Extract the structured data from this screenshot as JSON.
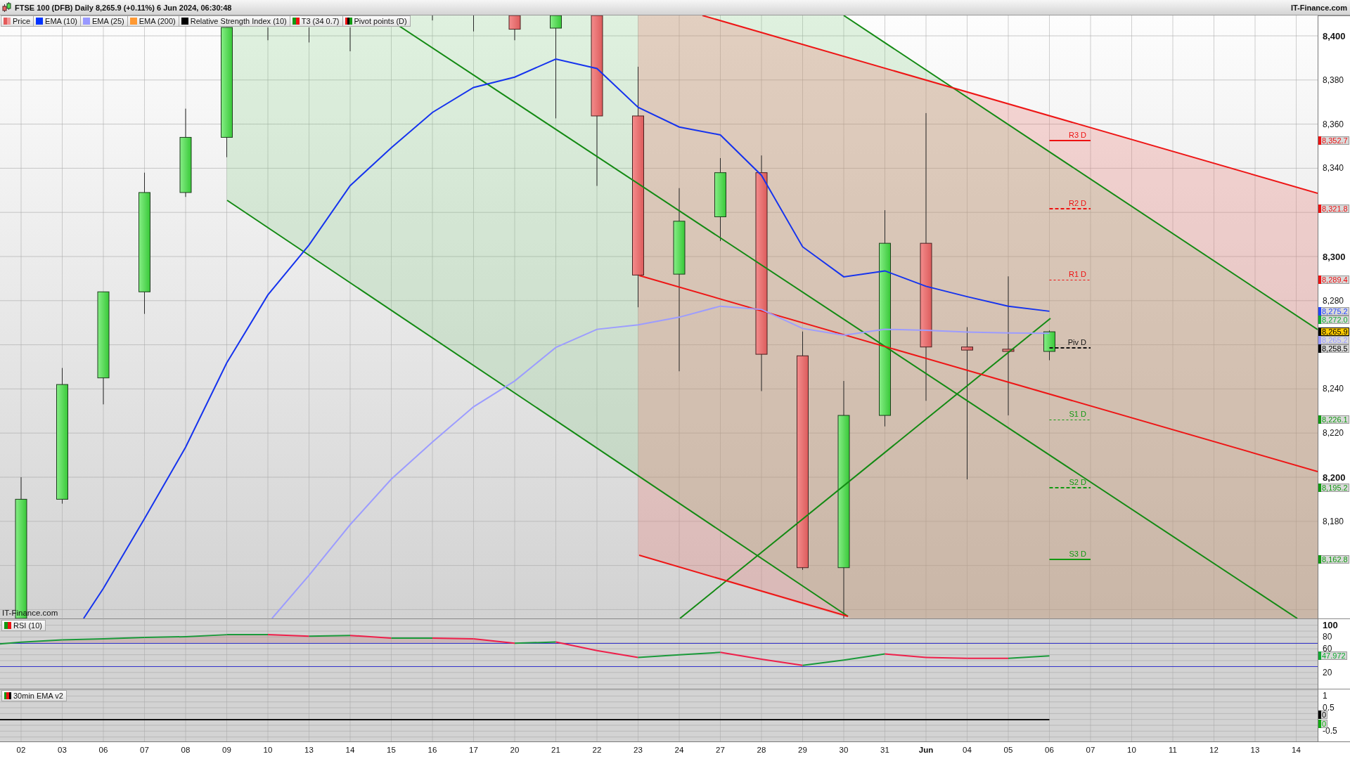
{
  "title_bar": {
    "title": "FTSE 100 (DFB) Daily 8,265.9 (+0.11%) 6 Jun 2024, 06:30:48",
    "site": "IT-Finance.com"
  },
  "legend": [
    {
      "label": "Price",
      "swatch": [
        {
          "color": "#e45a5a"
        },
        {
          "color": "#f29a9a"
        }
      ]
    },
    {
      "label": "EMA (10)",
      "swatch": [
        {
          "color": "#0033ff"
        }
      ]
    },
    {
      "label": "EMA (25)",
      "swatch": [
        {
          "color": "#9999ff"
        }
      ]
    },
    {
      "label": "EMA (200)",
      "swatch": [
        {
          "color": "#ff9933"
        }
      ]
    },
    {
      "label": "Relative Strength Index (10)",
      "swatch": [
        {
          "color": "#000000"
        }
      ]
    },
    {
      "label": "T3 (34 0.7)",
      "swatch": [
        {
          "color": "#119911"
        },
        {
          "color": "#ee1111"
        }
      ]
    },
    {
      "label": "Pivot points (D)",
      "swatch": [
        {
          "color": "#ee1111"
        },
        {
          "color": "#000000"
        },
        {
          "color": "#119911"
        }
      ]
    }
  ],
  "price_chart": {
    "pivots": [
      {
        "label": "R3 D",
        "color": "#ee1111",
        "dashed": false,
        "thin": false
      },
      {
        "label": "R2 D",
        "color": "#ee1111",
        "dashed": true,
        "thin": false
      },
      {
        "label": "R1 D",
        "color": "#ee1111",
        "dashed": true,
        "thin": true
      },
      {
        "label": "Piv D",
        "color": "#111111",
        "dashed": true,
        "thin": false
      },
      {
        "label": "S1 D",
        "color": "#119911",
        "dashed": true,
        "thin": true
      },
      {
        "label": "S2 D",
        "color": "#119911",
        "dashed": true,
        "thin": false
      },
      {
        "label": "S3 D",
        "color": "#119911",
        "dashed": false,
        "thin": false
      }
    ],
    "source_label": "IT-Finance.com",
    "axis": {
      "ticks": [
        {
          "text": "8,400",
          "major": true
        },
        {
          "text": "8,380",
          "major": false
        },
        {
          "text": "8,360",
          "major": false
        },
        {
          "text": "8,340",
          "major": false
        },
        {
          "text": "8,300",
          "major": true
        },
        {
          "text": "8,280",
          "major": false
        },
        {
          "text": "8,240",
          "major": false
        },
        {
          "text": "8,220",
          "major": false
        },
        {
          "text": "8,200",
          "major": true
        },
        {
          "text": "8,180",
          "major": false
        }
      ],
      "tags": [
        {
          "text": "8,352.7",
          "color": "#ee1111",
          "current": false
        },
        {
          "text": "8,321.8",
          "color": "#ee1111",
          "current": false
        },
        {
          "text": "8,289.4",
          "color": "#ee1111",
          "current": false
        },
        {
          "text": "8,275.2",
          "color": "#2244ff",
          "current": false
        },
        {
          "text": "8,272.0",
          "color": "#11aa33",
          "current": false
        },
        {
          "text": "8,265.9",
          "color": "#000000",
          "current": true
        },
        {
          "text": "8,265.2",
          "color": "#9999ff",
          "current": false
        },
        {
          "text": "8,258.5",
          "color": "#000000",
          "current": false
        },
        {
          "text": "8,226.1",
          "color": "#119911",
          "current": false
        },
        {
          "text": "8,195.2",
          "color": "#119911",
          "current": false
        },
        {
          "text": "8,162.8",
          "color": "#119911",
          "current": false
        }
      ]
    }
  },
  "rsi_panel": {
    "label": "RSI (10)",
    "swatch": [
      {
        "color": "#119911"
      },
      {
        "color": "#ee1111"
      }
    ],
    "axis": {
      "ticks": [
        {
          "text": "100",
          "major": true
        },
        {
          "text": "80",
          "major": false
        },
        {
          "text": "60",
          "major": false
        },
        {
          "text": "20",
          "major": false
        }
      ],
      "tags": [
        {
          "text": "47.972",
          "color": "#11aa33",
          "current": false
        }
      ]
    }
  },
  "oscillator_panel": {
    "label": "30min EMA v2",
    "swatch": [
      {
        "color": "#119911"
      },
      {
        "color": "#ee1111"
      },
      {
        "color": "#000000"
      }
    ],
    "axis": {
      "ticks": [
        {
          "text": "1",
          "major": false
        },
        {
          "text": "0.5",
          "major": false
        },
        {
          "text": "-0.5",
          "major": false
        }
      ],
      "tags": [
        {
          "text": "0",
          "color": "#000000",
          "current": false
        },
        {
          "text": "0",
          "color": "#11aa11",
          "current": false
        }
      ]
    }
  },
  "x_axis": {
    "dates": [
      {
        "text": "02",
        "major": false
      },
      {
        "text": "03",
        "major": false
      },
      {
        "text": "06",
        "major": false
      },
      {
        "text": "07",
        "major": false
      },
      {
        "text": "08",
        "major": false
      },
      {
        "text": "09",
        "major": false
      },
      {
        "text": "10",
        "major": false
      },
      {
        "text": "13",
        "major": false
      },
      {
        "text": "14",
        "major": false
      },
      {
        "text": "15",
        "major": false
      },
      {
        "text": "16",
        "major": false
      },
      {
        "text": "17",
        "major": false
      },
      {
        "text": "20",
        "major": false
      },
      {
        "text": "21",
        "major": false
      },
      {
        "text": "22",
        "major": false
      },
      {
        "text": "23",
        "major": false
      },
      {
        "text": "24",
        "major": false
      },
      {
        "text": "27",
        "major": false
      },
      {
        "text": "28",
        "major": false
      },
      {
        "text": "29",
        "major": false
      },
      {
        "text": "30",
        "major": false
      },
      {
        "text": "31",
        "major": false
      },
      {
        "text": "Jun",
        "major": true
      },
      {
        "text": "04",
        "major": false
      },
      {
        "text": "05",
        "major": false
      },
      {
        "text": "06",
        "major": false
      },
      {
        "text": "07",
        "major": false
      },
      {
        "text": "10",
        "major": false
      },
      {
        "text": "11",
        "major": false
      },
      {
        "text": "12",
        "major": false
      },
      {
        "text": "13",
        "major": false
      },
      {
        "text": "14",
        "major": false
      }
    ]
  }
}
